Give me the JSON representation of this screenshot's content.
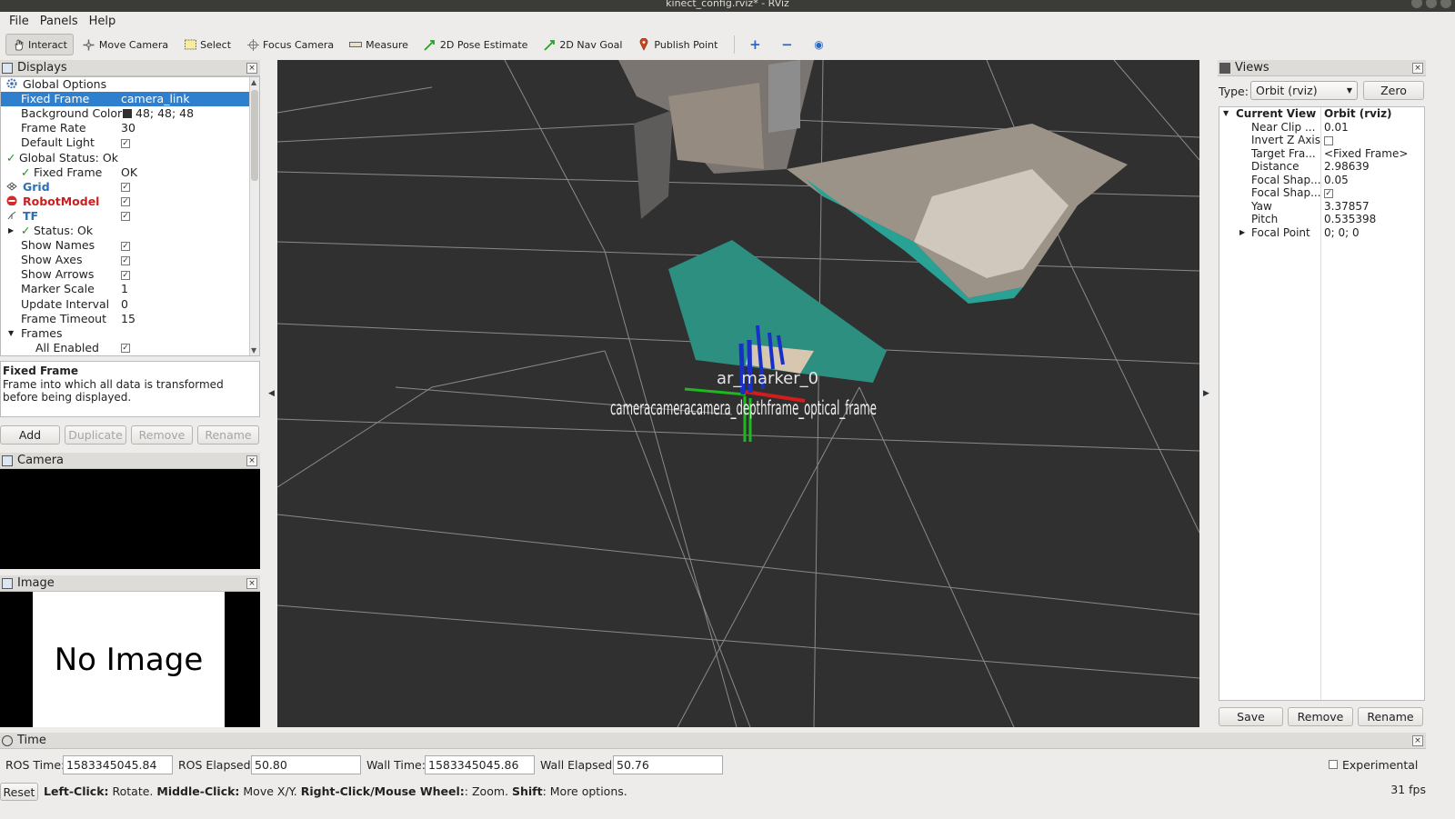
{
  "window": {
    "title": "kinect_config.rviz* - RViz"
  },
  "menu": [
    {
      "label": "File"
    },
    {
      "label": "Panels"
    },
    {
      "label": "Help"
    }
  ],
  "toolbar": [
    {
      "label": "Interact",
      "icon": "hand-icon"
    },
    {
      "label": "Move Camera",
      "icon": "move-camera-icon"
    },
    {
      "label": "Select",
      "icon": "select-icon"
    },
    {
      "label": "Focus Camera",
      "icon": "focus-icon"
    },
    {
      "label": "Measure",
      "icon": "ruler-icon"
    },
    {
      "label": "2D Pose Estimate",
      "icon": "pose-arrow-icon"
    },
    {
      "label": "2D Nav Goal",
      "icon": "goal-arrow-icon"
    },
    {
      "label": "Publish Point",
      "icon": "pin-icon"
    }
  ],
  "displays": {
    "title": "Displays",
    "rows": [
      {
        "key": "Global Options",
        "value": "",
        "indent": 1,
        "icon": "gear-icon",
        "expand": ""
      },
      {
        "key": "Fixed Frame",
        "value": "camera_link",
        "indent": 2,
        "selected": true
      },
      {
        "key": "Background Color",
        "value": "48; 48; 48",
        "indent": 2,
        "swatch": "#303030"
      },
      {
        "key": "Frame Rate",
        "value": "30",
        "indent": 2
      },
      {
        "key": "Default Light",
        "value": "",
        "indent": 2,
        "check": true
      },
      {
        "key": "Global Status: Ok",
        "value": "",
        "indent": 1,
        "status": "ok"
      },
      {
        "key": "Fixed Frame",
        "value": "OK",
        "indent": 2,
        "status": "ok"
      },
      {
        "key": "Grid",
        "value": "",
        "indent": 1,
        "check": true,
        "color": "#2a6fb8",
        "bold": true,
        "icon": "grid-icon"
      },
      {
        "key": "RobotModel",
        "value": "",
        "indent": 1,
        "check": true,
        "color": "#cc1f1f",
        "bold": true,
        "icon": "error-icon"
      },
      {
        "key": "TF",
        "value": "",
        "indent": 1,
        "check": true,
        "color": "#2a6fb8",
        "bold": true,
        "icon": "tf-icon"
      },
      {
        "key": "Status: Ok",
        "value": "",
        "indent": 2,
        "status": "ok",
        "expand": "right"
      },
      {
        "key": "Show Names",
        "value": "",
        "indent": 2,
        "check": true
      },
      {
        "key": "Show Axes",
        "value": "",
        "indent": 2,
        "check": true
      },
      {
        "key": "Show Arrows",
        "value": "",
        "indent": 2,
        "check": true
      },
      {
        "key": "Marker Scale",
        "value": "1",
        "indent": 2
      },
      {
        "key": "Update Interval",
        "value": "0",
        "indent": 2
      },
      {
        "key": "Frame Timeout",
        "value": "15",
        "indent": 2
      },
      {
        "key": "Frames",
        "value": "",
        "indent": 2,
        "expand": "down"
      },
      {
        "key": "All Enabled",
        "value": "",
        "indent": 3,
        "check": true
      }
    ],
    "description_title": "Fixed Frame",
    "description": "Frame into which all data is transformed before being displayed.",
    "buttons": [
      {
        "label": "Add",
        "enabled": true
      },
      {
        "label": "Duplicate",
        "enabled": false
      },
      {
        "label": "Remove",
        "enabled": false
      },
      {
        "label": "Rename",
        "enabled": false
      }
    ]
  },
  "camera_panel": {
    "title": "Camera"
  },
  "image_panel": {
    "title": "Image",
    "placeholder": "No Image"
  },
  "viewport": {
    "background": "#303030",
    "frame_labels": "cameracameracamera_depthframe_optical_frame",
    "marker_label": "ar_marker_0"
  },
  "views": {
    "title": "Views",
    "type_label": "Type:",
    "type_value": "Orbit (rviz)",
    "zero_button": "Zero",
    "rows": [
      {
        "key": "Current View",
        "value": "Orbit (rviz)",
        "bold": true,
        "expand": "down",
        "indent": 0
      },
      {
        "key": "Near Clip ...",
        "value": "0.01"
      },
      {
        "key": "Invert Z Axis",
        "value": "",
        "check": false
      },
      {
        "key": "Target Fra...",
        "value": "<Fixed Frame>"
      },
      {
        "key": "Distance",
        "value": "2.98639"
      },
      {
        "key": "Focal Shap...",
        "value": "0.05"
      },
      {
        "key": "Focal Shap...",
        "value": "",
        "check": true
      },
      {
        "key": "Yaw",
        "value": "3.37857"
      },
      {
        "key": "Pitch",
        "value": "0.535398"
      },
      {
        "key": "Focal Point",
        "value": "0; 0; 0",
        "expand": "right"
      }
    ],
    "buttons": [
      {
        "label": "Save"
      },
      {
        "label": "Remove"
      },
      {
        "label": "Rename"
      }
    ]
  },
  "time": {
    "title": "Time",
    "ros_time_label": "ROS Time:",
    "ros_time": "1583345045.84",
    "ros_elapsed_label": "ROS Elapsed:",
    "ros_elapsed": "50.80",
    "wall_time_label": "Wall Time:",
    "wall_time": "1583345045.86",
    "wall_elapsed_label": "Wall Elapsed:",
    "wall_elapsed": "50.76",
    "experimental": "Experimental"
  },
  "status": {
    "reset": "Reset",
    "hint_1b": "Left-Click:",
    "hint_1": " Rotate. ",
    "hint_2b": "Middle-Click:",
    "hint_2": " Move X/Y. ",
    "hint_3b": "Right-Click/Mouse Wheel:",
    "hint_3": ": Zoom. ",
    "hint_4b": "Shift",
    "hint_4": ": More options.",
    "fps": "31 fps"
  }
}
